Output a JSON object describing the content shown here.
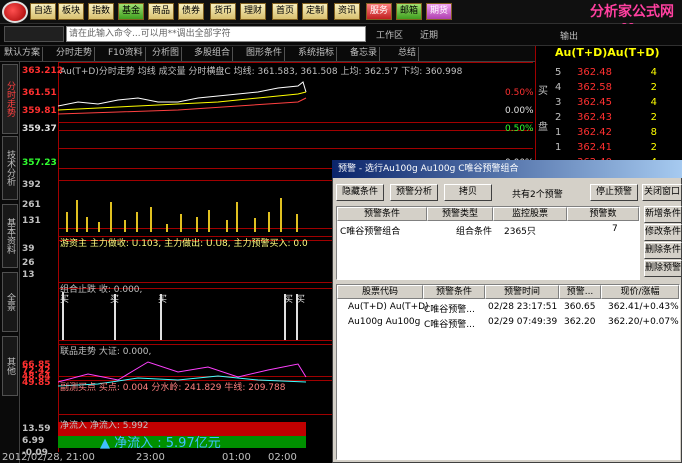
{
  "toolbar": {
    "buttons": [
      "自选",
      "板块",
      "指数",
      "基金",
      "商品",
      "债券",
      "货币",
      "理财",
      "首页",
      "定制",
      "资讯",
      "服务",
      "邮箱",
      "期货"
    ]
  },
  "watermark": {
    "brand": "分析家公式网",
    "url": "www.88gs.com"
  },
  "bar2": {
    "command_placeholder": "请在此输入命令...可以用**调出全部字符",
    "labels": [
      "工作区",
      "近期"
    ],
    "right_label": "输出"
  },
  "bar3": {
    "tabs": [
      "默认方案",
      "分时走势",
      "F10资料",
      "分析图",
      "多股组合",
      "图形条件",
      "系统指标",
      "备忘录",
      "总结"
    ]
  },
  "left_tabs": [
    {
      "label": "分时走势",
      "active": true
    },
    {
      "label": "技术分析",
      "active": false
    },
    {
      "label": "基本资料",
      "active": false
    },
    {
      "label": "全景",
      "active": false
    },
    {
      "label": "其他",
      "active": false
    }
  ],
  "chart": {
    "header": "Au(T+D)分时走势  均线  成交量  分时横盘C  均线: 361.583, 361.508  上均: 362.5'7  下均: 360.998",
    "price_labels": [
      "363.212",
      "361.51",
      "359.81",
      "359.37",
      "357.23",
      "392",
      "261",
      "131",
      "39",
      "26",
      "13"
    ],
    "pct_labels": [
      "0.50%",
      "0.00%",
      "0.50%",
      "0.00%",
      "0.01%"
    ],
    "sub1_label": "游资主  主力做收: U.103, 主力做出: U.U8, 主力预警买入: 0.0",
    "sub2_label": "组合止跌  收: 0.000,",
    "sub2_marks": [
      "买",
      "买",
      "买",
      "买",
      "买"
    ],
    "sub3_label": "联品走势  大证: 0.000,",
    "sub3_values": [
      "66.85",
      "72.42",
      "48.64",
      "49.85"
    ],
    "sub4_label": "副测买点  买点: 0.004  分水岭: 241.829  牛线: 209.788",
    "sub5_label": "净流入  净流入: 5.992",
    "sub5_values": [
      "13.59",
      "6.99",
      "-0.09"
    ],
    "flow_text": "▲ 净流入 : 5.97亿元",
    "time_labels": [
      "2012/02/28, 21:00",
      "23:00",
      "01:00",
      "02:00"
    ],
    "bottom_left": "1"
  },
  "quote_panel": {
    "title": "Au(T+D)Au(T+D)",
    "rows": [
      {
        "n": "5",
        "p": "362.48",
        "v": "4"
      },
      {
        "n": "4",
        "p": "362.58",
        "v": "2"
      },
      {
        "n": "3",
        "p": "362.45",
        "v": "4"
      },
      {
        "n": "2",
        "p": "362.43",
        "v": "2"
      },
      {
        "n": "1",
        "p": "362.42",
        "v": "8"
      },
      {
        "n": "1",
        "p": "362.41",
        "v": "2"
      },
      {
        "n": "",
        "p": "362.40",
        "v": "4"
      }
    ],
    "side_labels": [
      "买",
      "盘"
    ]
  },
  "dialog": {
    "title": "预警 - 选行Au100g Au100g C唯谷预警组合",
    "buttons": [
      "隐藏条件",
      "预警分析",
      "拷贝",
      "停止预警",
      "关闭窗口"
    ],
    "count_text": "共有2个预警",
    "side_buttons": [
      "新增条件",
      "修改条件",
      "删除条件",
      "删除预警"
    ],
    "cond_headers": [
      "预警条件",
      "预警类型",
      "监控股票",
      "预警数"
    ],
    "cond_rows": [
      [
        "C唯谷预警组合",
        "组合条件",
        "2365只",
        "7"
      ]
    ],
    "alert_headers": [
      "股票代码",
      "预警条件",
      "预警时间",
      "预警...",
      "现价/涨幅"
    ],
    "alert_rows": [
      [
        "Au(T+D) Au(T+D)",
        "C唯谷预警...",
        "02/28 23:17:51",
        "360.65",
        "362.41/+0.43%"
      ],
      [
        "Au100g Au100g",
        "C唯谷预警...",
        "02/29 07:49:39",
        "362.20",
        "362.20/+0.07%"
      ]
    ]
  }
}
